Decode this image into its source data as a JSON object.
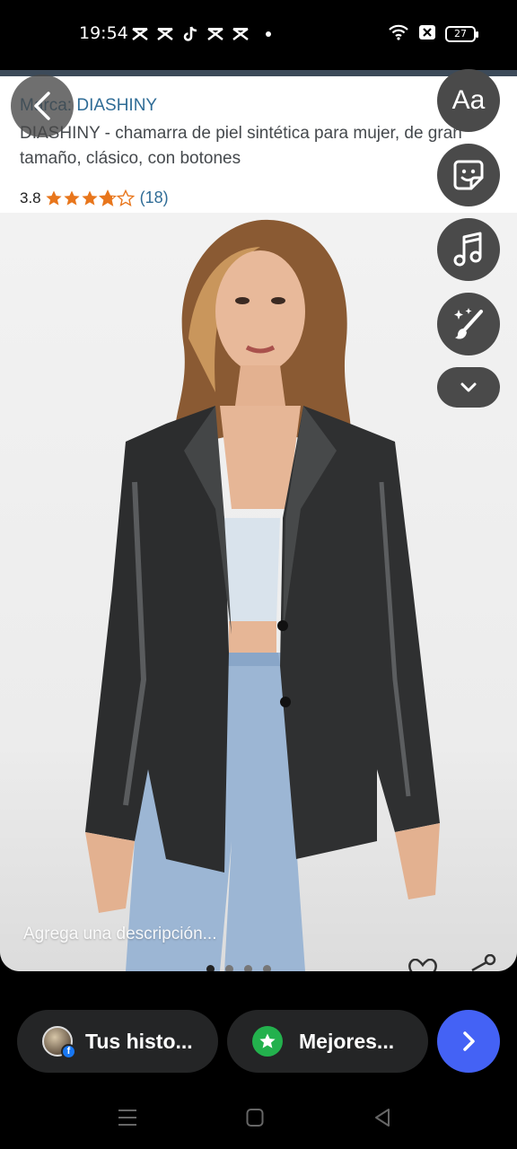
{
  "status_bar": {
    "time": "19:54",
    "battery": "27",
    "notification_icons": [
      "capcut-icon",
      "capcut-icon",
      "tiktok-icon",
      "capcut-icon",
      "capcut-icon"
    ],
    "system_icons": [
      "wifi-icon",
      "sim-off-icon",
      "battery-icon"
    ]
  },
  "story": {
    "product": {
      "brand": "Marca: DIASHINY",
      "title": "DIASHINY - chamarra de piel sintética para mujer, de gran tamaño, clásico, con botones",
      "rating_value": "3.8",
      "rating_stars": 3.8,
      "rating_count": "(18)"
    },
    "photo_subject": "woman-in-black-faux-leather-blazer",
    "caption_placeholder": "Agrega una descripción...",
    "page_count": 4,
    "current_page": 1
  },
  "editor_tools": {
    "text_tool_label": "Aa",
    "icons": [
      "sticker-icon",
      "music-icon",
      "effects-brush-icon",
      "chevron-down-icon"
    ]
  },
  "share_row": {
    "story_label": "Tus histo...",
    "friends_label": "Mejores...",
    "next_icon": "chevron-right-icon"
  },
  "colors": {
    "accent_blue": "#4462f5",
    "brand_link": "#2f6c96",
    "star_orange": "#e8761c",
    "green_star": "#23b14d",
    "tool_bg": "#4a4a4a",
    "pill_bg": "#242526"
  }
}
